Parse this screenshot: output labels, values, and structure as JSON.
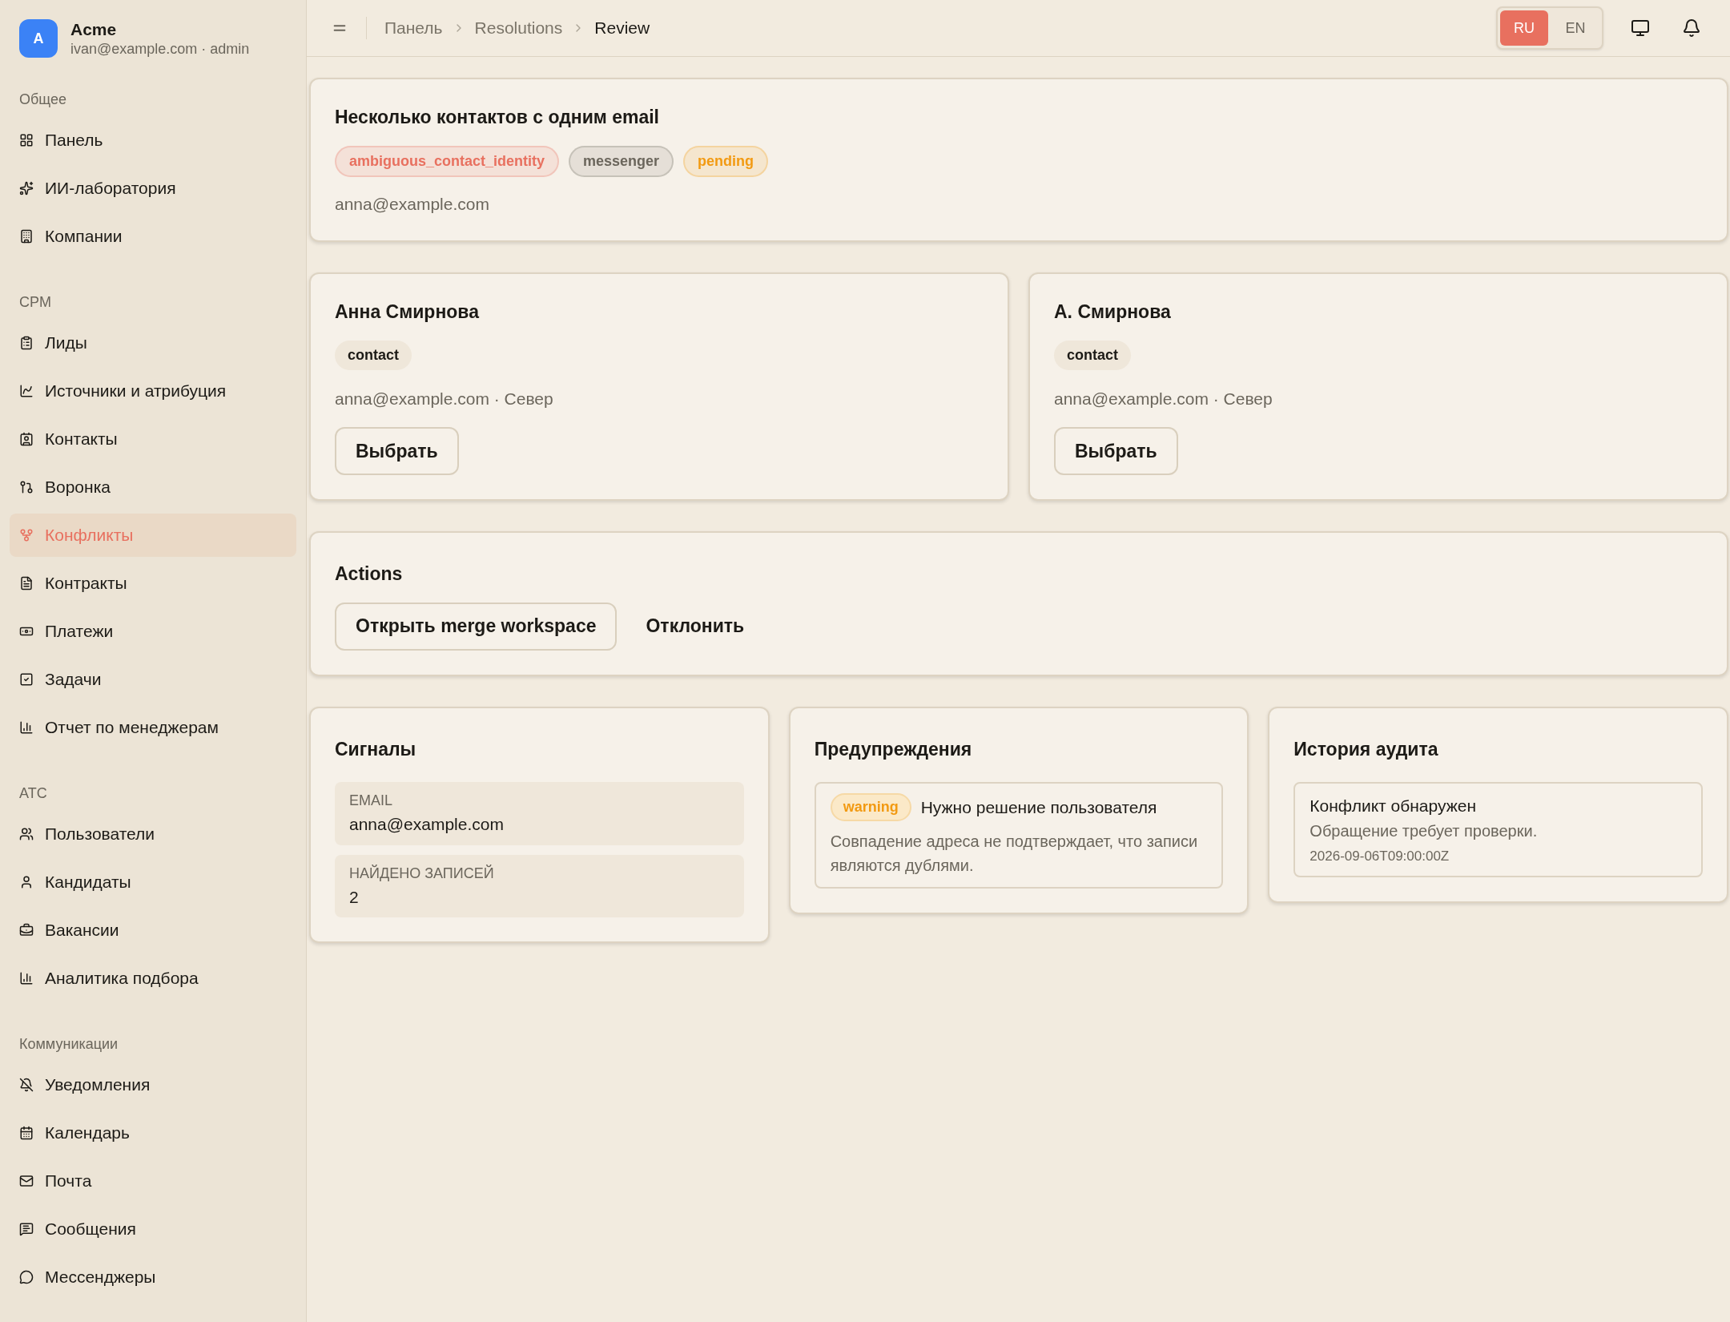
{
  "account": {
    "avatar": "A",
    "name": "Acme",
    "subtitle": "ivan@example.com · admin"
  },
  "sidebar": {
    "sections": [
      {
        "title": "Общее",
        "items": [
          {
            "label": "Панель",
            "selected": false
          },
          {
            "label": "ИИ-лаборатория",
            "selected": false
          },
          {
            "label": "Компании",
            "selected": false
          }
        ]
      },
      {
        "title": "CPM",
        "items": [
          {
            "label": "Лиды",
            "selected": false
          },
          {
            "label": "Источники и атрибуция",
            "selected": false
          },
          {
            "label": "Контакты",
            "selected": false
          },
          {
            "label": "Воронка",
            "selected": false
          },
          {
            "label": "Конфликты",
            "selected": true
          },
          {
            "label": "Контракты",
            "selected": false
          },
          {
            "label": "Платежи",
            "selected": false
          },
          {
            "label": "Задачи",
            "selected": false
          },
          {
            "label": "Отчет по менеджерам",
            "selected": false
          }
        ]
      },
      {
        "title": "ATC",
        "items": [
          {
            "label": "Пользователи",
            "selected": false
          },
          {
            "label": "Кандидаты",
            "selected": false
          },
          {
            "label": "Вакансии",
            "selected": false
          },
          {
            "label": "Аналитика подбора",
            "selected": false
          }
        ]
      },
      {
        "title": "Коммуникации",
        "items": [
          {
            "label": "Уведомления",
            "selected": false
          },
          {
            "label": "Календарь",
            "selected": false
          },
          {
            "label": "Почта",
            "selected": false
          },
          {
            "label": "Сообщения",
            "selected": false
          },
          {
            "label": "Мессенджеры",
            "selected": false
          }
        ]
      }
    ]
  },
  "breadcrumbs": [
    "Панель",
    "Resolutions",
    "Review"
  ],
  "languages": [
    {
      "label": "RU",
      "selected": true
    },
    {
      "label": "EN",
      "selected": false
    }
  ],
  "conflict": {
    "title": "Несколько контактов с одним email",
    "tags": [
      {
        "label": "ambiguous_contact_identity",
        "color": "#e8705f"
      },
      {
        "label": "messenger",
        "color": "#6b665c"
      },
      {
        "label": "pending",
        "color": "#f29a12"
      }
    ],
    "email": "anna@example.com"
  },
  "candidates": [
    {
      "name": "Анна Смирнова",
      "tag": "contact",
      "details": "anna@example.com · Север",
      "button": "Выбрать"
    },
    {
      "name": "А. Смирнова",
      "tag": "contact",
      "details": "anna@example.com · Север",
      "button": "Выбрать"
    }
  ],
  "actions": {
    "title": "Actions",
    "primary": "Открыть merge workspace",
    "secondary": "Отклонить"
  },
  "signals": {
    "title": "Сигналы",
    "rows": [
      {
        "label": "EMAIL",
        "value": "anna@example.com"
      },
      {
        "label": "НАЙДЕНО ЗАПИСЕЙ",
        "value": "2"
      }
    ]
  },
  "warnings": {
    "title": "Предупреждения",
    "items": [
      {
        "badge": "warning",
        "title": "Нужно решение пользователя",
        "text": "Совпадение адреса не подтверждает, что записи являются дублями."
      }
    ]
  },
  "audit": {
    "title": "История аудита",
    "items": [
      {
        "title": "Конфликт обнаружен",
        "text": "Обращение требует проверки.",
        "time": "2026-09-06T09:00:00Z"
      }
    ]
  }
}
